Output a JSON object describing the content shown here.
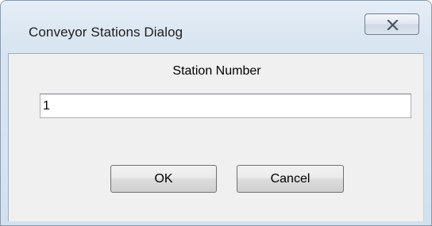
{
  "window": {
    "title": "Conveyor Stations Dialog",
    "close_icon": "close-x-icon"
  },
  "form": {
    "station_label": "Station Number",
    "station_value": "1"
  },
  "buttons": {
    "ok_label": "OK",
    "cancel_label": "Cancel"
  },
  "colors": {
    "title_bar": "#d9e5f1",
    "client_bg": "#f0f0f0"
  }
}
